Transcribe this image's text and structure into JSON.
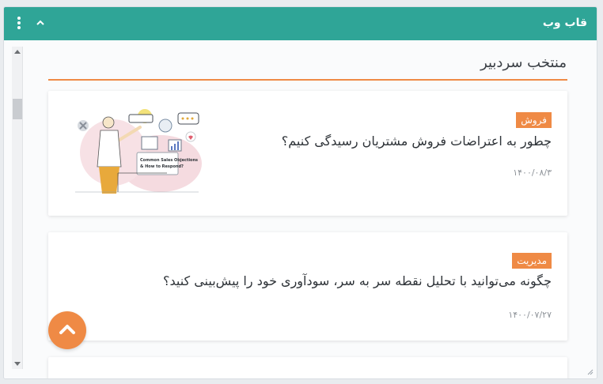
{
  "window": {
    "title": "قاب وب"
  },
  "section": {
    "title": "منتخب سردبیر"
  },
  "articles": [
    {
      "category": "فروش",
      "headline": "چطور به اعتراضات فروش مشتریان رسیدگی کنیم؟",
      "date": "۱۴۰۰/۰۸/۳",
      "thumbnail_caption": "Common Sales Objections & How to Respond?"
    },
    {
      "category": "مدیریت",
      "headline": "چگونه می‌توانید با تحلیل نقطه سر به سر، سودآوری خود را پیش‌بینی کنید؟",
      "date": "۱۴۰۰/۰۷/۲۷"
    }
  ],
  "colors": {
    "header": "#2fa597",
    "accent": "#ef8a45"
  }
}
